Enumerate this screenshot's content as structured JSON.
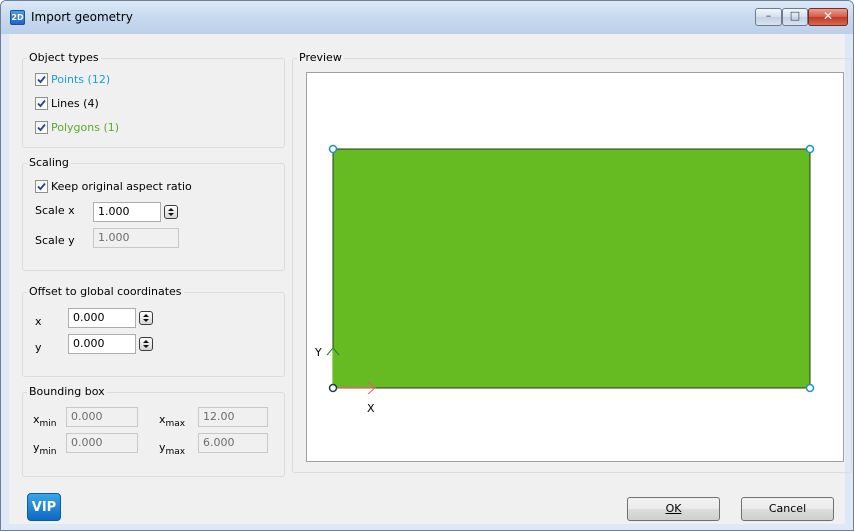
{
  "window": {
    "icon_text": "2D",
    "title": "Import geometry",
    "minimize_glyph": "–",
    "maximize_glyph": "□",
    "close_glyph": "✕"
  },
  "object_types": {
    "title": "Object types",
    "items": [
      {
        "label": "Points (12)",
        "checked": true,
        "color": "#1a9fd8"
      },
      {
        "label": "Lines (4)",
        "checked": true,
        "color": "#000000"
      },
      {
        "label": "Polygons (1)",
        "checked": true,
        "color": "#5aaa2a"
      }
    ]
  },
  "scaling": {
    "title": "Scaling",
    "keep_aspect_label": "Keep original aspect ratio",
    "keep_aspect_checked": true,
    "scale_x_label": "Scale x",
    "scale_x_value": "1.000",
    "scale_y_label": "Scale y",
    "scale_y_value": "1.000"
  },
  "offset": {
    "title": "Offset to global coordinates",
    "x_label": "x",
    "x_value": "0.000",
    "y_label": "y",
    "y_value": "0.000"
  },
  "bounding_box": {
    "title": "Bounding box",
    "x_label": "x",
    "y_label": "y",
    "min_sub": "min",
    "max_sub": "max",
    "xmin": "0.000",
    "xmax": "12.00",
    "ymin": "0.000",
    "ymax": "6.000"
  },
  "preview": {
    "title": "Preview",
    "axis_x_label": "X",
    "axis_y_label": "Y",
    "polygon_color": "#66bb22",
    "point_color": "#1a8fd8"
  },
  "footer": {
    "vip_label": "VIP",
    "ok_label": "OK",
    "cancel_label": "Cancel"
  }
}
